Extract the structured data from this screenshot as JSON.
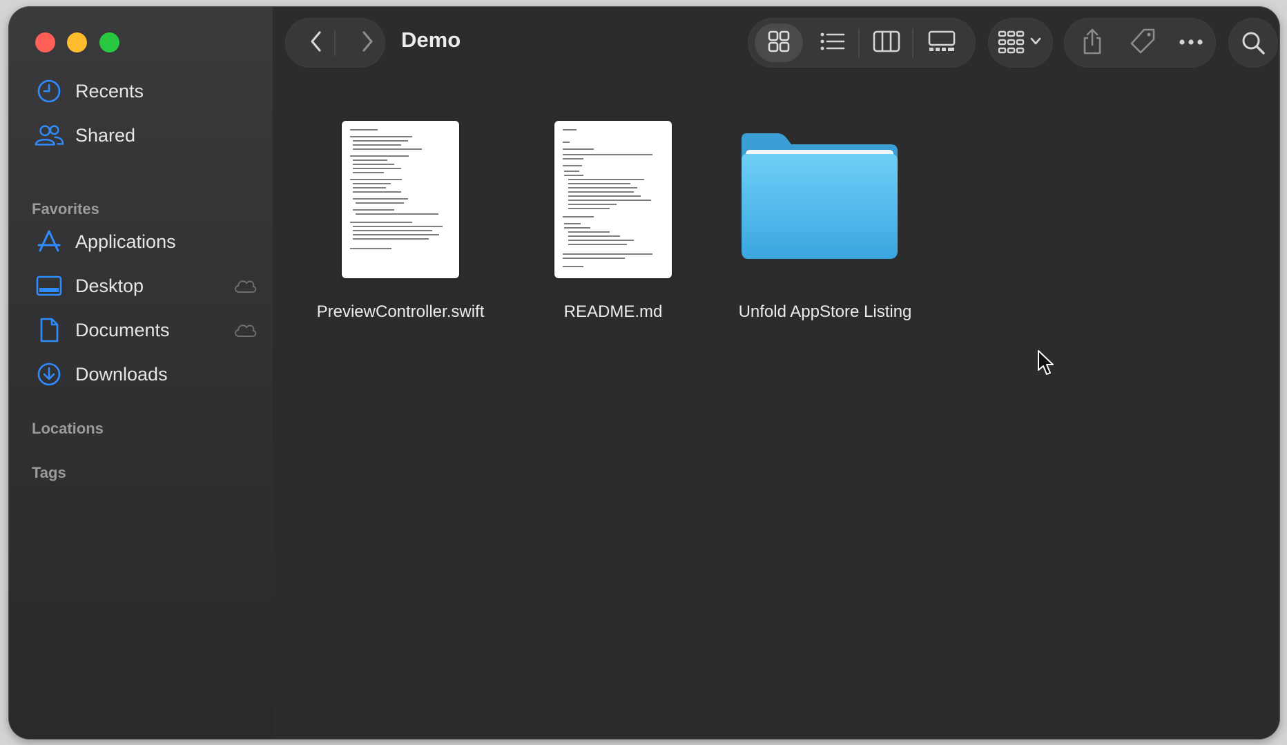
{
  "window": {
    "title": "Demo"
  },
  "sidebar": {
    "top_items": [
      {
        "label": "Recents",
        "icon": "clock-icon"
      },
      {
        "label": "Shared",
        "icon": "people-icon"
      }
    ],
    "favorites_header": "Favorites",
    "favorites": [
      {
        "label": "Applications",
        "icon": "app-store-icon",
        "icloud": false
      },
      {
        "label": "Desktop",
        "icon": "desktop-icon",
        "icloud": true
      },
      {
        "label": "Documents",
        "icon": "document-icon",
        "icloud": true
      },
      {
        "label": "Downloads",
        "icon": "download-icon",
        "icloud": false
      }
    ],
    "locations_header": "Locations",
    "tags_header": "Tags"
  },
  "toolbar": {
    "back_icon": "chevron-left-icon",
    "forward_icon": "chevron-right-icon",
    "view_modes": [
      "icon-view-icon",
      "list-view-icon",
      "column-view-icon",
      "gallery-view-icon"
    ],
    "active_view": "icon-view-icon",
    "group_icon": "group-by-icon",
    "share_icon": "share-icon",
    "tag_icon": "tag-icon",
    "more_icon": "ellipsis-icon",
    "search_icon": "search-icon"
  },
  "files": [
    {
      "name": "PreviewController.swift",
      "kind": "document"
    },
    {
      "name": "README.md",
      "kind": "document"
    },
    {
      "name": "Unfold AppStore Listing",
      "kind": "folder"
    }
  ],
  "colors": {
    "accent": "#0a84ff",
    "folder": "#4ab8ec",
    "close": "#fe5f57",
    "minimize": "#febc2e",
    "maximize": "#28c840"
  }
}
